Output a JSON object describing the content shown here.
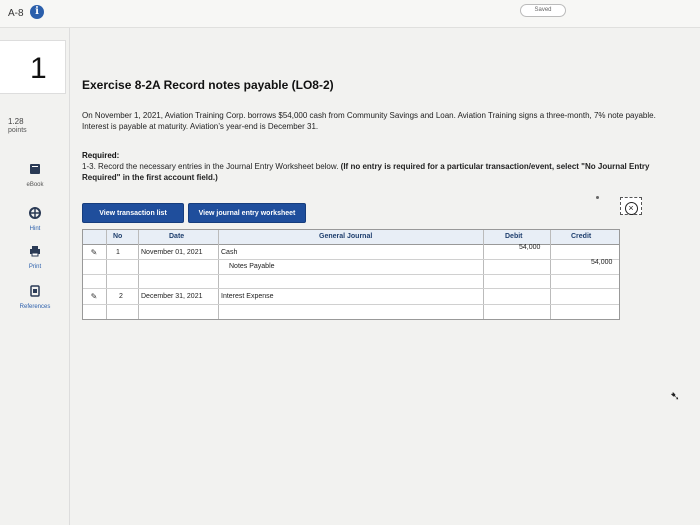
{
  "topbar": {
    "question_label": "A-8",
    "saved_label": "Saved"
  },
  "sidebar": {
    "question_number": "1",
    "points_value": "1.28",
    "points_label": "points",
    "tools": [
      {
        "label": "eBook",
        "icon": "book-icon"
      },
      {
        "label": "Hint",
        "icon": "hint-icon"
      },
      {
        "label": "Print",
        "icon": "print-icon"
      },
      {
        "label": "References",
        "icon": "references-icon"
      }
    ]
  },
  "exercise": {
    "title": "Exercise 8-2A Record notes payable (LO8-2)",
    "problem": "On November 1, 2021, Aviation Training Corp. borrows $54,000 cash from Community Savings and Loan. Aviation Training signs a three-month, 7% note payable. Interest is payable at maturity. Aviation’s year-end is December 31.",
    "required_heading": "Required:",
    "required_text": "1-3. Record the necessary entries in the Journal Entry Worksheet below.",
    "required_bold": "(If no entry is required for a particular transaction/event, select \"No Journal Entry Required\" in the first account field.)"
  },
  "buttons": {
    "view_transaction_list": "View transaction list",
    "view_journal_worksheet": "View journal entry worksheet",
    "close_symbol": "×"
  },
  "journal": {
    "headers": {
      "no": "No",
      "date": "Date",
      "general_journal": "General Journal",
      "debit": "Debit",
      "credit": "Credit"
    },
    "rows": [
      {
        "no": "1",
        "date": "November 01, 2021",
        "account": "Cash",
        "debit": "54,000",
        "credit": ""
      },
      {
        "no": "",
        "date": "",
        "account": "Notes Payable",
        "debit": "",
        "credit": "54,000"
      },
      {
        "no": "2",
        "date": "December 31, 2021",
        "account": "Interest Expense",
        "debit": "",
        "credit": ""
      }
    ]
  }
}
